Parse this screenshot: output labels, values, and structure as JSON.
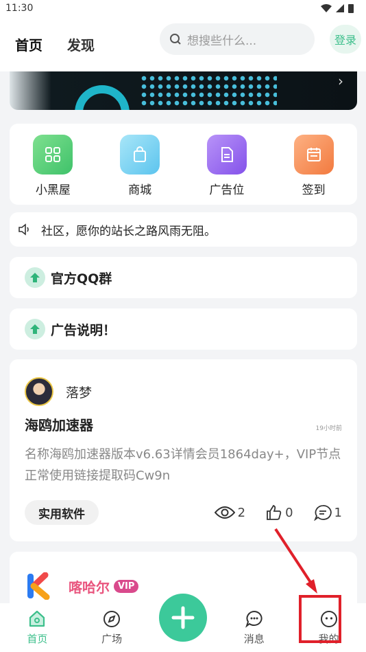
{
  "status": {
    "time": "11:30"
  },
  "header": {
    "tabs": [
      {
        "label": "首页",
        "active": true
      },
      {
        "label": "发现",
        "active": false
      }
    ],
    "search_placeholder": "想搜些什么...",
    "login_label": "登录"
  },
  "quick_links": [
    {
      "label": "小黑屋",
      "icon": "grid-icon",
      "color": "#5fd17c"
    },
    {
      "label": "商城",
      "icon": "shopping-bag-icon",
      "color": "#7ed3f2"
    },
    {
      "label": "广告位",
      "icon": "document-icon",
      "color": "#9b6df0"
    },
    {
      "label": "签到",
      "icon": "calendar-icon",
      "color": "#f7955c"
    }
  ],
  "notice": {
    "text": "社区，愿你的站长之路风雨无阻。"
  },
  "pinned": [
    {
      "label": "官方QQ群"
    },
    {
      "label": "广告说明！"
    }
  ],
  "post": {
    "author": "落梦",
    "title": "海鸥加速器",
    "time": "19小时前",
    "description": "名称海鸥加速器版本v6.63详情会员1864day+，VIP节点正常使用链接提取码Cw9n",
    "tag": "实用软件",
    "views": "2",
    "likes": "0",
    "comments": "1"
  },
  "post2": {
    "author": "喀哈尔",
    "badge": "VIP"
  },
  "bottom_nav": [
    {
      "label": "首页",
      "icon": "home-icon",
      "active": true
    },
    {
      "label": "广场",
      "icon": "compass-icon",
      "active": false
    },
    {
      "label": "消息",
      "icon": "chat-icon",
      "active": false
    },
    {
      "label": "我的",
      "icon": "profile-icon",
      "active": false
    }
  ],
  "colors": {
    "accent": "#3cbf8b",
    "highlight": "#e0202a"
  }
}
